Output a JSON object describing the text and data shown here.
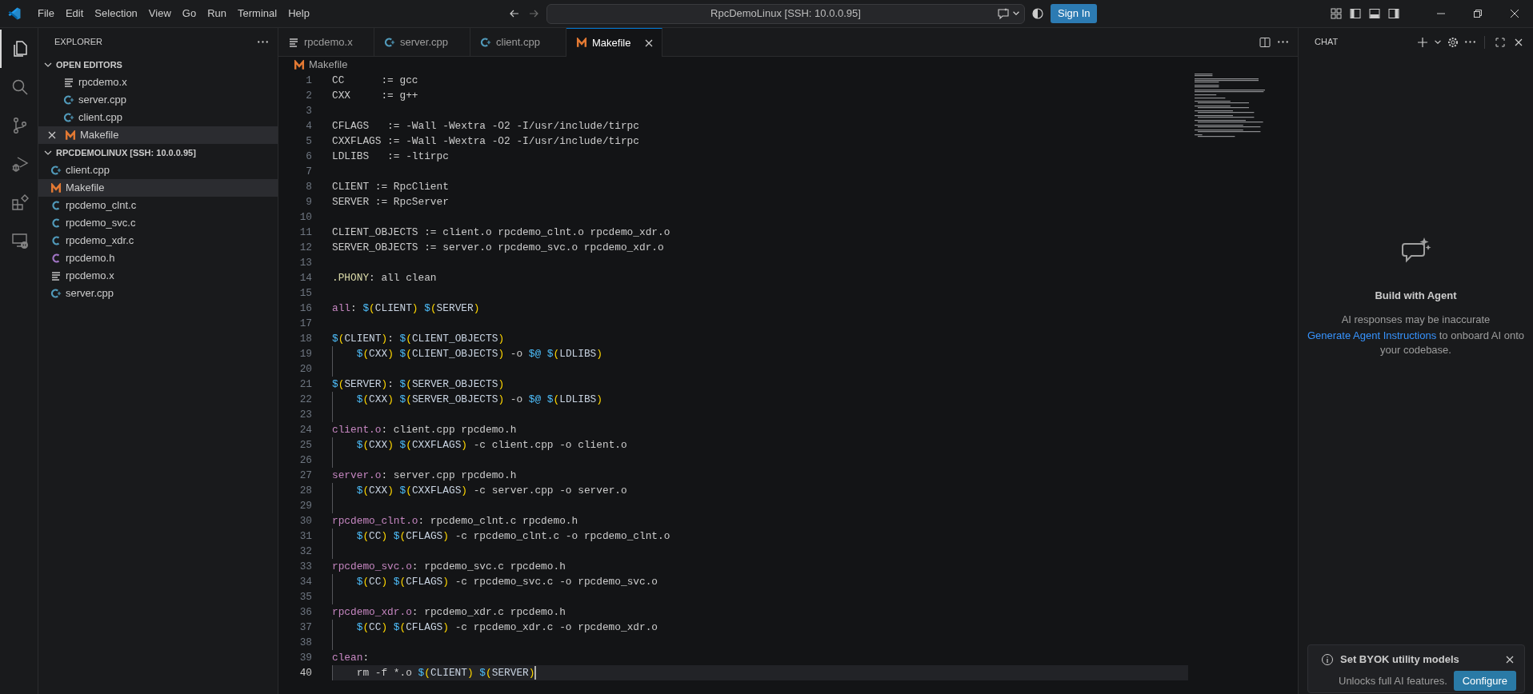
{
  "title_bar": {
    "menu": [
      "File",
      "Edit",
      "Selection",
      "View",
      "Go",
      "Run",
      "Terminal",
      "Help"
    ],
    "command_center": "RpcDemoLinux [SSH: 10.0.0.95]",
    "sign_in": "Sign In"
  },
  "activity_bar": [
    {
      "kind": "explorer",
      "selected": true
    },
    {
      "kind": "search",
      "selected": false
    },
    {
      "kind": "source_control",
      "selected": false
    },
    {
      "kind": "run_debug",
      "selected": false
    },
    {
      "kind": "extensions",
      "selected": false
    },
    {
      "kind": "remote",
      "selected": false
    }
  ],
  "sidebar": {
    "title": "EXPLORER",
    "sections": [
      {
        "title": "OPEN EDITORS",
        "expanded": true,
        "closable": true,
        "items": [
          {
            "label": "rpcdemo.x",
            "kind": "text",
            "selected": false
          },
          {
            "label": "server.cpp",
            "kind": "cpp",
            "selected": false
          },
          {
            "label": "client.cpp",
            "kind": "cpp",
            "selected": false
          },
          {
            "label": "Makefile",
            "kind": "makefile",
            "selected": true
          }
        ]
      },
      {
        "title": "RPCDEMOLINUX [SSH: 10.0.0.95]",
        "expanded": true,
        "closable": false,
        "items": [
          {
            "label": "client.cpp",
            "kind": "cpp",
            "selected": false
          },
          {
            "label": "Makefile",
            "kind": "makefile",
            "selected": true
          },
          {
            "label": "rpcdemo_clnt.c",
            "kind": "c",
            "selected": false
          },
          {
            "label": "rpcdemo_svc.c",
            "kind": "c",
            "selected": false
          },
          {
            "label": "rpcdemo_xdr.c",
            "kind": "c",
            "selected": false
          },
          {
            "label": "rpcdemo.h",
            "kind": "h",
            "selected": false
          },
          {
            "label": "rpcdemo.x",
            "kind": "text",
            "selected": false
          },
          {
            "label": "server.cpp",
            "kind": "cpp",
            "selected": false
          }
        ]
      }
    ]
  },
  "editor": {
    "tabs": [
      {
        "label": "rpcdemo.x",
        "kind": "text",
        "selected": false
      },
      {
        "label": "server.cpp",
        "kind": "cpp",
        "selected": false
      },
      {
        "label": "client.cpp",
        "kind": "cpp",
        "selected": false
      },
      {
        "label": "Makefile",
        "kind": "makefile",
        "selected": true
      }
    ],
    "breadcrumb": {
      "label": "Makefile",
      "kind": "makefile"
    },
    "lines": [
      {
        "number": "1",
        "text": "CC      := gcc",
        "indented": false,
        "current": false
      },
      {
        "number": "2",
        "text": "CXX     := g++",
        "indented": false,
        "current": false
      },
      {
        "number": "3",
        "indented": false,
        "current": false
      },
      {
        "number": "4",
        "text": "CFLAGS   := -Wall -Wextra -O2 -I/usr/include/tirpc",
        "indented": false,
        "current": false
      },
      {
        "number": "5",
        "text": "CXXFLAGS := -Wall -Wextra -O2 -I/usr/include/tirpc",
        "indented": false,
        "current": false
      },
      {
        "number": "6",
        "text": "LDLIBS   := -ltirpc",
        "indented": false,
        "current": false
      },
      {
        "number": "7",
        "indented": false,
        "current": false
      },
      {
        "number": "8",
        "text": "CLIENT := RpcClient",
        "indented": false,
        "current": false
      },
      {
        "number": "9",
        "text": "SERVER := RpcServer",
        "indented": false,
        "current": false
      },
      {
        "number": "10",
        "indented": false,
        "current": false
      },
      {
        "number": "11",
        "text": "CLIENT_OBJECTS := client.o rpcdemo_clnt.o rpcdemo_xdr.o",
        "indented": false,
        "current": false
      },
      {
        "number": "12",
        "text": "SERVER_OBJECTS := server.o rpcdemo_svc.o rpcdemo_xdr.o",
        "indented": false,
        "current": false
      },
      {
        "number": "13",
        "indented": false,
        "current": false
      },
      {
        "number": "14",
        "text": ".PHONY: all clean",
        "indented": false,
        "current": false
      },
      {
        "number": "15",
        "indented": false,
        "current": false
      },
      {
        "number": "16",
        "text": "all: $(CLIENT) $(SERVER)",
        "indented": false,
        "current": false
      },
      {
        "number": "17",
        "indented": false,
        "current": false
      },
      {
        "number": "18",
        "text": "$(CLIENT): $(CLIENT_OBJECTS)",
        "indented": false,
        "current": false
      },
      {
        "number": "19",
        "text": "$(CXX) $(CLIENT_OBJECTS) -o $@ $(LDLIBS)",
        "indented": true,
        "current": false
      },
      {
        "number": "20",
        "indented": true,
        "current": false
      },
      {
        "number": "21",
        "text": "$(SERVER): $(SERVER_OBJECTS)",
        "indented": false,
        "current": false
      },
      {
        "number": "22",
        "text": "$(CXX) $(SERVER_OBJECTS) -o $@ $(LDLIBS)",
        "indented": true,
        "current": false
      },
      {
        "number": "23",
        "indented": true,
        "current": false
      },
      {
        "number": "24",
        "text": "client.o: client.cpp rpcdemo.h",
        "indented": false,
        "current": false
      },
      {
        "number": "25",
        "text": "$(CXX) $(CXXFLAGS) -c client.cpp -o client.o",
        "indented": true,
        "current": false
      },
      {
        "number": "26",
        "indented": true,
        "current": false
      },
      {
        "number": "27",
        "text": "server.o: server.cpp rpcdemo.h",
        "indented": false,
        "current": false
      },
      {
        "number": "28",
        "text": "$(CXX) $(CXXFLAGS) -c server.cpp -o server.o",
        "indented": true,
        "current": false
      },
      {
        "number": "29",
        "indented": true,
        "current": false
      },
      {
        "number": "30",
        "text": "rpcdemo_clnt.o: rpcdemo_clnt.c rpcdemo.h",
        "indented": false,
        "current": false
      },
      {
        "number": "31",
        "text": "$(CC) $(CFLAGS) -c rpcdemo_clnt.c -o rpcdemo_clnt.o",
        "indented": true,
        "current": false
      },
      {
        "number": "32",
        "indented": true,
        "current": false
      },
      {
        "number": "33",
        "text": "rpcdemo_svc.o: rpcdemo_svc.c rpcdemo.h",
        "indented": false,
        "current": false
      },
      {
        "number": "34",
        "text": "$(CC) $(CFLAGS) -c rpcdemo_svc.c -o rpcdemo_svc.o",
        "indented": true,
        "current": false
      },
      {
        "number": "35",
        "indented": true,
        "current": false
      },
      {
        "number": "36",
        "text": "rpcdemo_xdr.o: rpcdemo_xdr.c rpcdemo.h",
        "indented": false,
        "current": false
      },
      {
        "number": "37",
        "text": "$(CC) $(CFLAGS) -c rpcdemo_xdr.c -o rpcdemo_xdr.o",
        "indented": true,
        "current": false
      },
      {
        "number": "38",
        "indented": true,
        "current": false
      },
      {
        "number": "39",
        "text": "clean:",
        "indented": false,
        "current": false
      },
      {
        "number": "40",
        "text": "rm -f *.o $(CLIENT) $(SERVER)",
        "indented": true,
        "current": true
      }
    ]
  },
  "chat": {
    "title": "CHAT",
    "heading": "Build with Agent",
    "note": "AI responses may be inaccurate",
    "link": "Generate Agent Instructions",
    "link_tail": " to onboard AI onto your codebase."
  },
  "notification": {
    "title": "Set BYOK utility models",
    "message": "Unlocks full AI features.",
    "button": "Configure"
  }
}
